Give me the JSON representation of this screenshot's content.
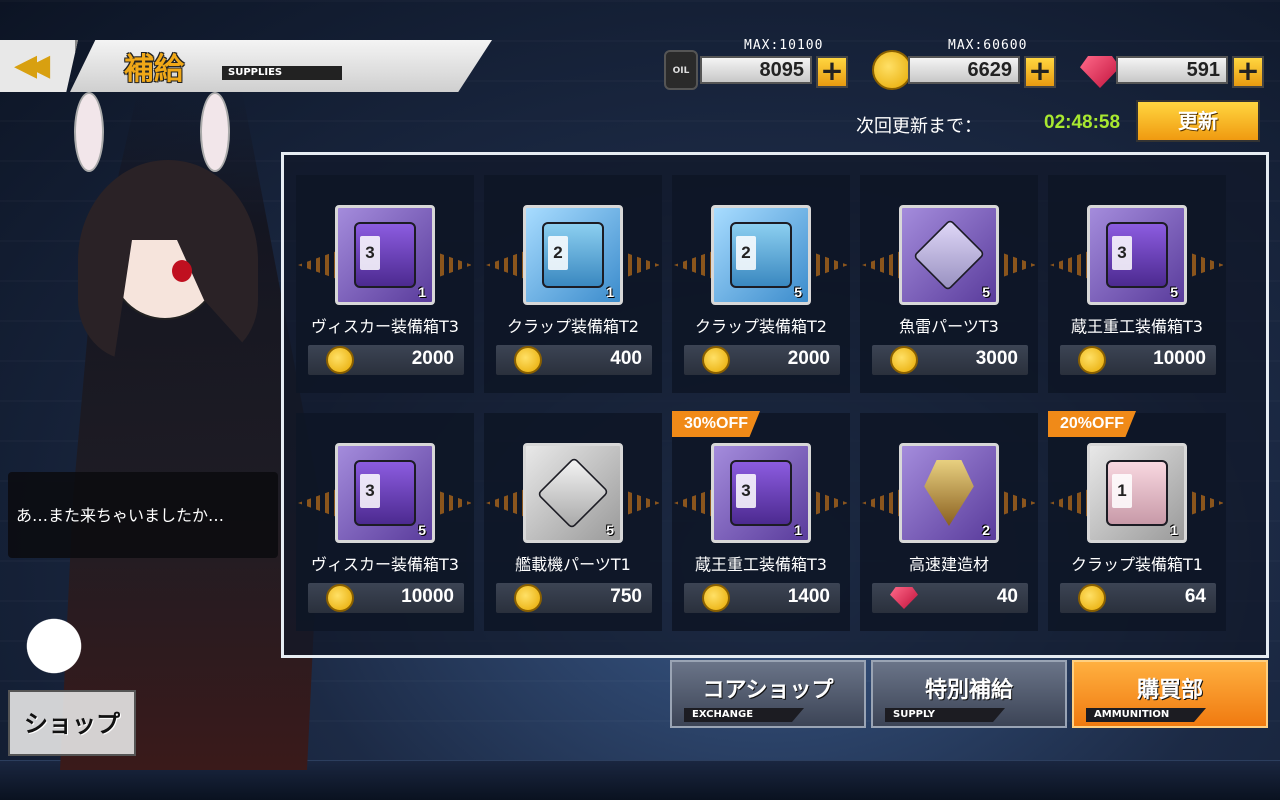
{
  "header": {
    "title": "補給",
    "subtitle": "SUPPLIES"
  },
  "resources": {
    "oil": {
      "max": "MAX:10100",
      "value": "8095",
      "icon": "oil-barrel-icon",
      "icon_label": "OIL"
    },
    "coins": {
      "max": "MAX:60600",
      "value": "6629",
      "icon": "coin-icon"
    },
    "gems": {
      "value": "591",
      "icon": "gem-icon"
    }
  },
  "refresh": {
    "label": "次回更新まで：",
    "time": "02:48:58",
    "button": "更新"
  },
  "character": {
    "dialog": "あ…また来ちゃいましたか…",
    "shop_label": "ショップ"
  },
  "items": [
    {
      "name": "ヴィスカー装備箱T3",
      "price": "2000",
      "currency": "coin",
      "qty": "1",
      "tier": "3",
      "box": "purple",
      "rarity": "purple",
      "tag": ""
    },
    {
      "name": "クラップ装備箱T2",
      "price": "400",
      "currency": "coin",
      "qty": "1",
      "tier": "2",
      "box": "blue",
      "rarity": "blue",
      "tag": ""
    },
    {
      "name": "クラップ装備箱T2",
      "price": "2000",
      "currency": "coin",
      "qty": "5",
      "tier": "2",
      "box": "blue",
      "rarity": "blue",
      "tag": ""
    },
    {
      "name": "魚雷パーツT3",
      "price": "3000",
      "currency": "coin",
      "qty": "5",
      "tier": "",
      "box": "lid",
      "rarity": "purple",
      "tag": ""
    },
    {
      "name": "蔵王重工装備箱T3",
      "price": "10000",
      "currency": "coin",
      "qty": "5",
      "tier": "3",
      "box": "purple",
      "rarity": "purple",
      "tag": ""
    },
    {
      "name": "ヴィスカー装備箱T3",
      "price": "10000",
      "currency": "coin",
      "qty": "5",
      "tier": "3",
      "box": "purple",
      "rarity": "purple",
      "tag": ""
    },
    {
      "name": "艦載機パーツT1",
      "price": "750",
      "currency": "coin",
      "qty": "5",
      "tier": "",
      "box": "lid-grey",
      "rarity": "grey",
      "tag": ""
    },
    {
      "name": "蔵王重工装備箱T3",
      "price": "1400",
      "currency": "coin",
      "qty": "1",
      "tier": "3",
      "box": "purple",
      "rarity": "purple",
      "tag": "30%OFF"
    },
    {
      "name": "高速建造材",
      "price": "40",
      "currency": "gem",
      "qty": "2",
      "tier": "",
      "box": "drill",
      "rarity": "purple",
      "tag": ""
    },
    {
      "name": "クラップ装備箱T1",
      "price": "64",
      "currency": "coin",
      "qty": "1",
      "tier": "1",
      "box": "pink",
      "rarity": "grey",
      "tag": "20%OFF"
    }
  ],
  "tabs": [
    {
      "label": "コアショップ",
      "sub": "EXCHANGE",
      "active": false
    },
    {
      "label": "特別補給",
      "sub": "SUPPLY",
      "active": false
    },
    {
      "label": "購買部",
      "sub": "AMMUNITION",
      "active": true
    }
  ],
  "colors": {
    "accent": "#f0a818",
    "timer": "#a8e830",
    "discount_tag": "#f08a18"
  }
}
